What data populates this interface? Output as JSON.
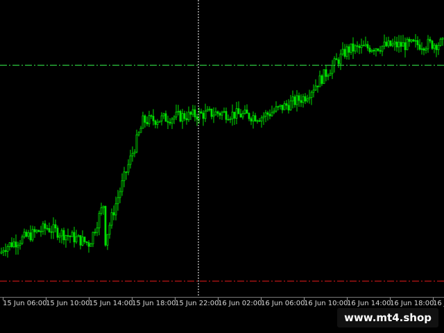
{
  "colors": {
    "background": "#000000",
    "candle": "#00e000",
    "level_green": "#2ecc40",
    "level_red": "#d01818",
    "crosshair": "#ffffff",
    "axis_text": "#d8d8d8"
  },
  "time_axis": {
    "labels": [
      "15 Jun 06:00",
      "15 Jun 10:00",
      "15 Jun 14:00",
      "15 Jun 18:00",
      "15 Jun 22:00",
      "16 Jun 02:00",
      "16 Jun 06:00",
      "16 Jun 10:00",
      "16 Jun 14:00",
      "16 Jun 18:00",
      "16 Jun 2"
    ]
  },
  "watermark": {
    "text": "www.mt4.shop"
  },
  "chart_data": {
    "type": "line",
    "x": [
      "15 Jun 06:00",
      "15 Jun 10:00",
      "15 Jun 14:00",
      "15 Jun 18:00",
      "15 Jun 22:00",
      "16 Jun 02:00",
      "16 Jun 06:00",
      "16 Jun 10:00",
      "16 Jun 14:00",
      "16 Jun 18:00"
    ],
    "series": [
      {
        "values": [
          10,
          20,
          12,
          73,
          76,
          78,
          76,
          86,
          110,
          112
        ]
      }
    ],
    "ylim": [
      -15,
      135
    ],
    "horizontal_levels": [
      {
        "value": 102,
        "style": "dash-dot",
        "color": "#2ecc40"
      },
      {
        "value": -7,
        "style": "dash-dot",
        "color": "#d01818"
      }
    ],
    "crosshair_x": "15 Jun 22:00",
    "grid": false
  }
}
